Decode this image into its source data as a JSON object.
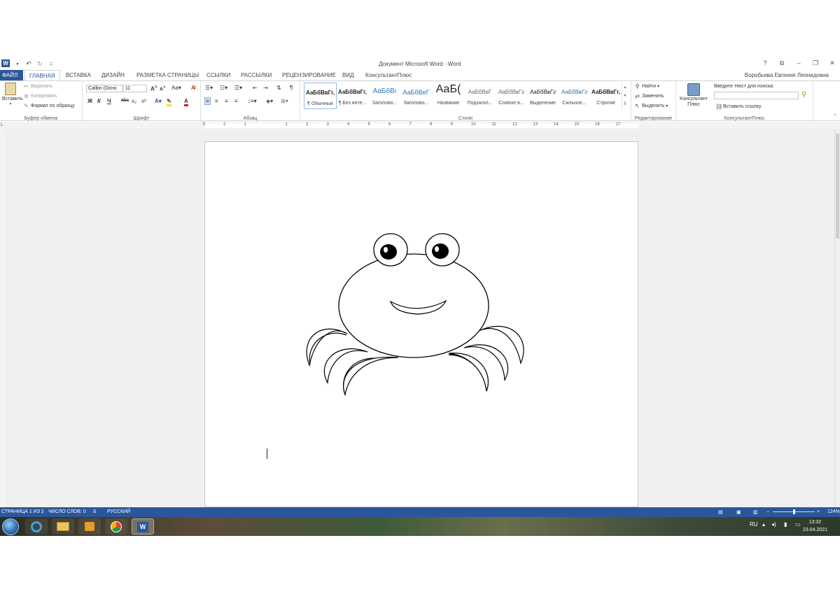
{
  "window": {
    "title": "Документ Microsoft Word - Word",
    "user": "Воробьева Евгения Леонидовна",
    "controls": [
      "?",
      "⧉",
      "–",
      "❐",
      "✕"
    ]
  },
  "tabs": [
    "ФАЙЛ",
    "ГЛАВНАЯ",
    "ВСТАВКА",
    "ДИЗАЙН",
    "РАЗМЕТКА СТРАНИЦЫ",
    "ССЫЛКИ",
    "РАССЫЛКИ",
    "РЕЦЕНЗИРОВАНИЕ",
    "ВИД",
    "КонсультантПлюс"
  ],
  "clipboard": {
    "paste": "Вставить",
    "cut": "Вырезать",
    "copy": "Копировать",
    "format_painter": "Формат по образцу",
    "label": "Буфер обмена"
  },
  "font": {
    "name": "Calibri (Осно",
    "size": "11",
    "label": "Шрифт",
    "bold": "Ж",
    "italic": "К",
    "underline": "Ч",
    "strike": "abc",
    "subscript": "x₂",
    "superscript": "x²"
  },
  "paragraph": {
    "label": "Абзац"
  },
  "styles": {
    "label": "Стили",
    "items": [
      {
        "sample": "АаБбВвГг,",
        "name": "¶ Обычный"
      },
      {
        "sample": "АаБбВвГг,",
        "name": "¶ Без инте..."
      },
      {
        "sample": "АаБбВı",
        "name": "Заголово..."
      },
      {
        "sample": "АаБбВеГ",
        "name": "Заголово..."
      },
      {
        "sample": "АаБ(",
        "name": "Название"
      },
      {
        "sample": "АаБбВвГ",
        "name": "Подзагол..."
      },
      {
        "sample": "АаБбВвГг",
        "name": "Слабое в..."
      },
      {
        "sample": "АаБбВвГг",
        "name": "Выделение"
      },
      {
        "sample": "АаБбВвГг",
        "name": "Сильное..."
      },
      {
        "sample": "АаБбВвГг,",
        "name": "Строгий"
      }
    ]
  },
  "editing": {
    "find": "Найти",
    "replace": "Заменить",
    "select": "Выделить",
    "label": "Редактирование"
  },
  "consultant": {
    "button": "Консультант Плюс",
    "search_label": "Введите текст для поиска:",
    "insert_link": "Вставить ссылку",
    "label": "КонсультантПлюс"
  },
  "ruler": {
    "numbers": [
      "3",
      "2",
      "1",
      "1",
      "2",
      "3",
      "4",
      "5",
      "6",
      "7",
      "8",
      "9",
      "10",
      "11",
      "12",
      "13",
      "14",
      "15",
      "16",
      "17"
    ]
  },
  "status": {
    "page": "СТРАНИЦА 1 ИЗ 2",
    "words": "ЧИСЛО СЛОВ: 0",
    "language": "РУССКИЙ",
    "zoom": "124%"
  },
  "taskbar": {
    "lang": "RU",
    "time": "13:32",
    "date": "23.04.2021"
  },
  "icons": [
    "word-logo",
    "save-icon",
    "undo-icon",
    "redo-icon",
    "customize-icon",
    "paste-icon",
    "cut-icon",
    "copy-icon",
    "format-painter-icon",
    "find-icon",
    "replace-icon",
    "select-icon",
    "consultant-icon",
    "search-icon",
    "link-icon"
  ]
}
